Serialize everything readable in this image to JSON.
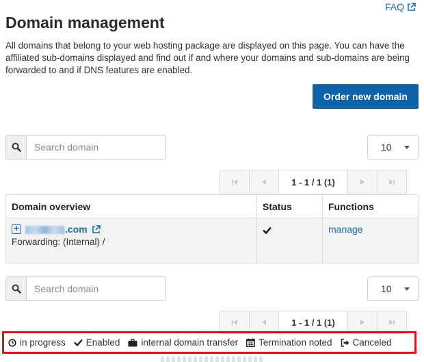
{
  "header": {
    "faq_label": "FAQ",
    "title": "Domain management",
    "description": "All domains that belong to your web hosting package are displayed on this page. You can have the affiliated sub-domains displayed and find out if and where your domains and sub-domains are being forwarded to and if DNS features are enabled."
  },
  "order_button_label": "Order new domain",
  "search": {
    "placeholder": "Search domain"
  },
  "page_size": {
    "selected": "10"
  },
  "pagination": {
    "info": "1 - 1 / 1 (1)"
  },
  "table": {
    "headers": {
      "domain": "Domain overview",
      "status": "Status",
      "functions": "Functions"
    },
    "rows": [
      {
        "domain_suffix": ".com",
        "forwarding": "Forwarding: (Internal) /",
        "status_icon": "check-icon",
        "function_label": "manage"
      }
    ]
  },
  "legend": [
    {
      "icon": "clock-icon",
      "label": "in progress"
    },
    {
      "icon": "check-icon",
      "label": "Enabled"
    },
    {
      "icon": "briefcase-icon",
      "label": "internal domain transfer"
    },
    {
      "icon": "calendar-icon",
      "label": "Termination noted"
    },
    {
      "icon": "sign-out-icon",
      "label": "Canceled"
    }
  ],
  "colors": {
    "primary_button": "#0d62a8",
    "link": "#1a6aaf",
    "highlight_border": "#e1101a",
    "row_background": "#f3f3f3"
  }
}
